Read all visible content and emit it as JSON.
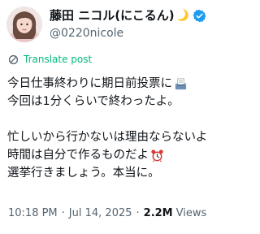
{
  "author": {
    "display_name": "藤田 ニコル(にこるん)",
    "handle": "@0220nicole",
    "moon_glyph": "🌙",
    "verified_color": "#1d9bf0",
    "avatar_icon": "profile-photo"
  },
  "translate": {
    "label": "Translate post",
    "icon": "translate-icon",
    "color": "#00ba7c"
  },
  "tweet": {
    "line1": "今日仕事終わりに期日前投票に",
    "line1_emoji": "ballot-box-icon",
    "line2": "今回は1分くらいで終わったよ。",
    "line3": "忙しいから行かないは理由ならないよ",
    "line4": "時間は自分で作るものだよ",
    "line4_emoji": "alarm-clock-icon",
    "line5": "選挙行きましょう。本当に。"
  },
  "meta": {
    "time": "10:18 PM",
    "separator": "·",
    "date": "Jul 14, 2025",
    "views_count": "2.2M",
    "views_label": "Views"
  }
}
